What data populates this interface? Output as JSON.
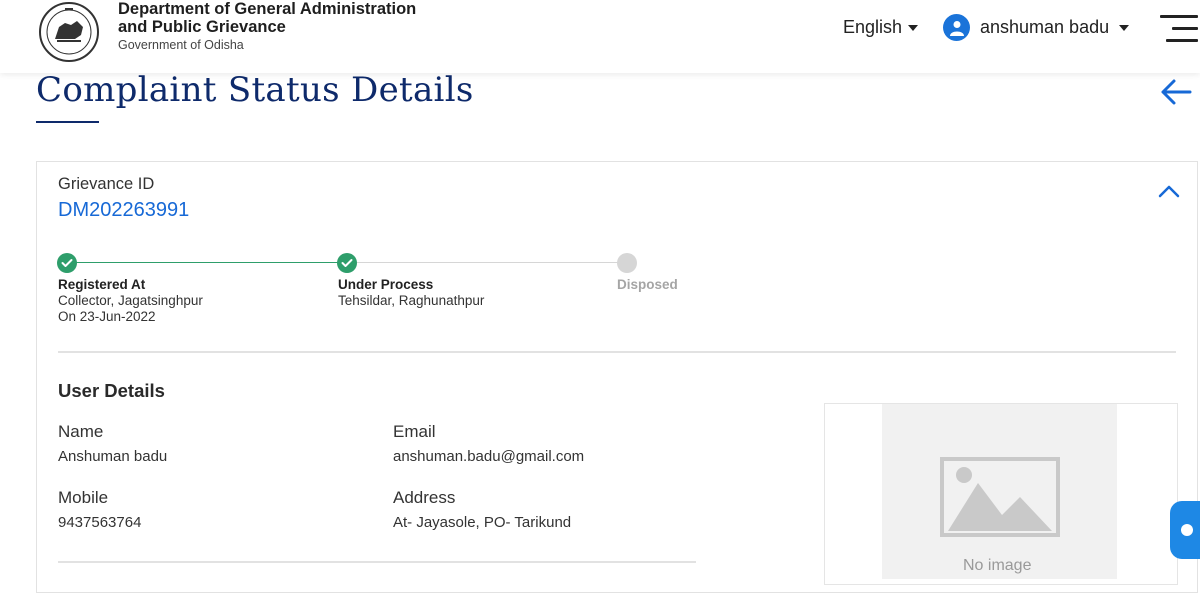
{
  "header": {
    "dept_title": "Department of General Administration and Public Grievance",
    "dept_sub": "Government of Odisha",
    "language": "English",
    "user_name": "anshuman badu"
  },
  "page": {
    "title": "Complaint Status Details"
  },
  "grievance": {
    "label": "Grievance ID",
    "id": "DM202263991"
  },
  "steps": [
    {
      "title": "Registered At",
      "lines": [
        "Collector, Jagatsinghpur",
        "On 23-Jun-2022"
      ],
      "done": true
    },
    {
      "title": "Under Process",
      "lines": [
        "Tehsildar, Raghunathpur"
      ],
      "done": true
    },
    {
      "title": "Disposed",
      "lines": [],
      "done": false
    }
  ],
  "user_details": {
    "section_title": "User Details",
    "name_label": "Name",
    "name_value": "Anshuman badu",
    "email_label": "Email",
    "email_value": "anshuman.badu@gmail.com",
    "mobile_label": "Mobile",
    "mobile_value": "9437563764",
    "address_label": "Address",
    "address_value": "At- Jayasole, PO- Tarikund"
  },
  "image": {
    "placeholder_text": "No image"
  },
  "colors": {
    "accent": "#1769d6",
    "title": "#0e2a6b",
    "step_done": "#2e9e6b",
    "step_pending": "#d6d6d6"
  }
}
